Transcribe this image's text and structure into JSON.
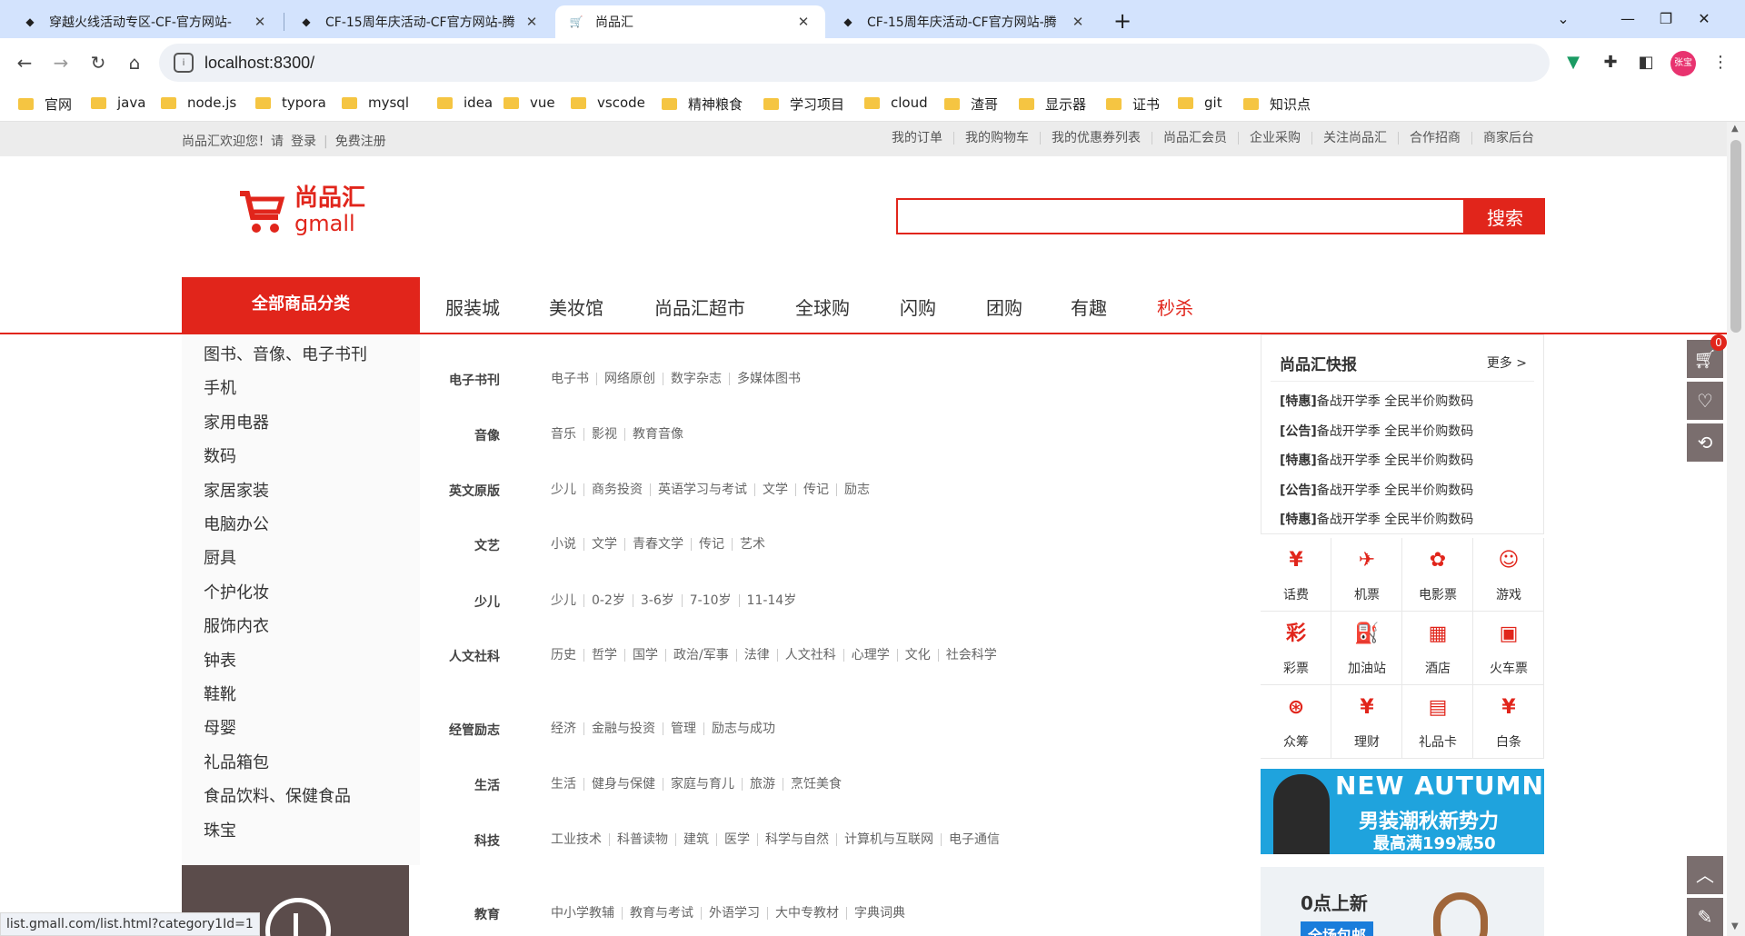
{
  "browser": {
    "tabs": [
      {
        "title": "穿越火线活动专区-CF-官方网站-"
      },
      {
        "title": "CF-15周年庆活动-CF官方网站-腾"
      },
      {
        "title": "尚品汇"
      },
      {
        "title": "CF-15周年庆活动-CF官方网站-腾"
      }
    ],
    "new_tab": "+",
    "url": "localhost:8300/",
    "avatar": "张宝",
    "bookmarks": [
      "官网",
      "java",
      "node.js",
      "typora",
      "mysql",
      "idea",
      "vue",
      "vscode",
      "精神粮食",
      "学习项目",
      "cloud",
      "渣哥",
      "显示器",
      "证书",
      "git",
      "知识点"
    ],
    "status_url": "list.gmall.com/list.html?category1Id=1"
  },
  "topbar": {
    "welcome": "尚品汇欢迎您！请",
    "login": "登录",
    "register": "免费注册",
    "links": [
      "我的订单",
      "我的购物车",
      "我的优惠券列表",
      "尚品汇会员",
      "企业采购",
      "关注尚品汇",
      "合作招商",
      "商家后台"
    ]
  },
  "header": {
    "logo_cn": "尚品汇",
    "logo_en": "gmall",
    "search_placeholder": "",
    "search_button": "搜索"
  },
  "nav": {
    "all_categories": "全部商品分类",
    "links": [
      "服装城",
      "美妆馆",
      "尚品汇超市",
      "全球购",
      "闪购",
      "团购",
      "有趣",
      "秒杀"
    ],
    "highlight_color": "#e1251b"
  },
  "categories": [
    "图书、音像、电子书刊",
    "手机",
    "家用电器",
    "数码",
    "家居家装",
    "电脑办公",
    "厨具",
    "个护化妆",
    "服饰内衣",
    "钟表",
    "鞋靴",
    "母婴",
    "礼品箱包",
    "食品饮料、保健食品",
    "珠宝"
  ],
  "submenu": [
    {
      "title": "电子书刊",
      "items": [
        "电子书",
        "网络原创",
        "数字杂志",
        "多媒体图书"
      ]
    },
    {
      "title": "音像",
      "items": [
        "音乐",
        "影视",
        "教育音像"
      ]
    },
    {
      "title": "英文原版",
      "items": [
        "少儿",
        "商务投资",
        "英语学习与考试",
        "文学",
        "传记",
        "励志"
      ]
    },
    {
      "title": "文艺",
      "items": [
        "小说",
        "文学",
        "青春文学",
        "传记",
        "艺术"
      ]
    },
    {
      "title": "少儿",
      "items": [
        "少儿",
        "0-2岁",
        "3-6岁",
        "7-10岁",
        "11-14岁"
      ]
    },
    {
      "title": "人文社科",
      "items": [
        "历史",
        "哲学",
        "国学",
        "政治/军事",
        "法律",
        "人文社科",
        "心理学",
        "文化",
        "社会科学"
      ]
    },
    {
      "title": "经管励志",
      "items": [
        "经济",
        "金融与投资",
        "管理",
        "励志与成功"
      ]
    },
    {
      "title": "生活",
      "items": [
        "生活",
        "健身与保健",
        "家庭与育儿",
        "旅游",
        "烹饪美食"
      ]
    },
    {
      "title": "科技",
      "items": [
        "工业技术",
        "科普读物",
        "建筑",
        "医学",
        "科学与自然",
        "计算机与互联网",
        "电子通信"
      ]
    },
    {
      "title": "教育",
      "items": [
        "中小学教辅",
        "教育与考试",
        "外语学习",
        "大中专教材",
        "字典词典"
      ]
    }
  ],
  "news": {
    "title": "尚品汇快报",
    "more": "更多 >",
    "items": [
      {
        "tag": "[特惠]",
        "text": "备战开学季 全民半价购数码"
      },
      {
        "tag": "[公告]",
        "text": "备战开学季 全民半价购数码"
      },
      {
        "tag": "[特惠]",
        "text": "备战开学季 全民半价购数码"
      },
      {
        "tag": "[公告]",
        "text": "备战开学季 全民半价购数码"
      },
      {
        "tag": "[特惠]",
        "text": "备战开学季 全民半价购数码"
      }
    ]
  },
  "services": [
    {
      "label": "话费",
      "icon": "phone-icon",
      "glyph": "¥"
    },
    {
      "label": "机票",
      "icon": "plane-icon",
      "glyph": "✈"
    },
    {
      "label": "电影票",
      "icon": "film-icon",
      "glyph": "✿"
    },
    {
      "label": "游戏",
      "icon": "gamepad-icon",
      "glyph": "☺"
    },
    {
      "label": "彩票",
      "icon": "lottery-icon",
      "glyph": "彩"
    },
    {
      "label": "加油站",
      "icon": "gas-station-icon",
      "glyph": "⛽"
    },
    {
      "label": "酒店",
      "icon": "hotel-icon",
      "glyph": "▦"
    },
    {
      "label": "火车票",
      "icon": "train-icon",
      "glyph": "▣"
    },
    {
      "label": "众筹",
      "icon": "crowdfunding-icon",
      "glyph": "⊛"
    },
    {
      "label": "理财",
      "icon": "finance-icon",
      "glyph": "¥"
    },
    {
      "label": "礼品卡",
      "icon": "gift-card-icon",
      "glyph": "▤"
    },
    {
      "label": "白条",
      "icon": "credit-icon",
      "glyph": "¥"
    }
  ],
  "promo": {
    "line1": "NEW AUTUMN",
    "line2": "男装潮秋新势力",
    "line3": "最高满199减50"
  },
  "promo2": {
    "title": "0点上新",
    "badge": "全场包邮"
  },
  "sidebar": {
    "cart_count": "0"
  }
}
